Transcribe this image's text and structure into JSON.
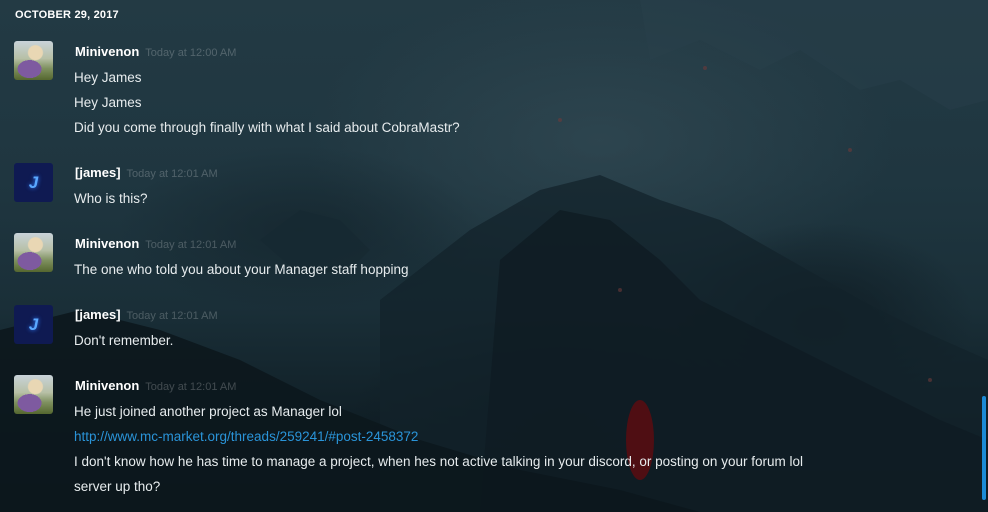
{
  "date_header": "OCTOBER 29, 2017",
  "colors": {
    "link": "#2a94d8",
    "scroll_thumb": "#1b8ad6",
    "timestamp": "#4b5a60"
  },
  "messages": [
    {
      "author": "Minivenon",
      "timestamp": "Today at 12:00 AM",
      "avatar_icon": "user-photo-avatar",
      "lines": [
        "Hey James",
        "Hey James",
        "Did you come through finally with what I said about CobraMastr?"
      ]
    },
    {
      "author": "[james]",
      "timestamp": "Today at 12:01 AM",
      "avatar_icon": "j-logo-avatar",
      "avatar_glyph": "J",
      "lines": [
        "Who is this?"
      ]
    },
    {
      "author": "Minivenon",
      "timestamp": "Today at 12:01 AM",
      "avatar_icon": "user-photo-avatar",
      "lines": [
        "The one who told you about your Manager staff hopping"
      ]
    },
    {
      "author": "[james]",
      "timestamp": "Today at 12:01 AM",
      "avatar_icon": "j-logo-avatar",
      "avatar_glyph": "J",
      "lines": [
        "Don't remember."
      ]
    },
    {
      "author": "Minivenon",
      "timestamp": "Today at 12:01 AM",
      "avatar_icon": "user-photo-avatar",
      "lines": [
        "He just joined another project as Manager lol",
        "http://www.mc-market.org/threads/259241/#post-2458372",
        "I don't know how he has time to manage a project, when hes not active talking in your discord, or posting on your forum lol",
        "server up tho?"
      ]
    }
  ]
}
